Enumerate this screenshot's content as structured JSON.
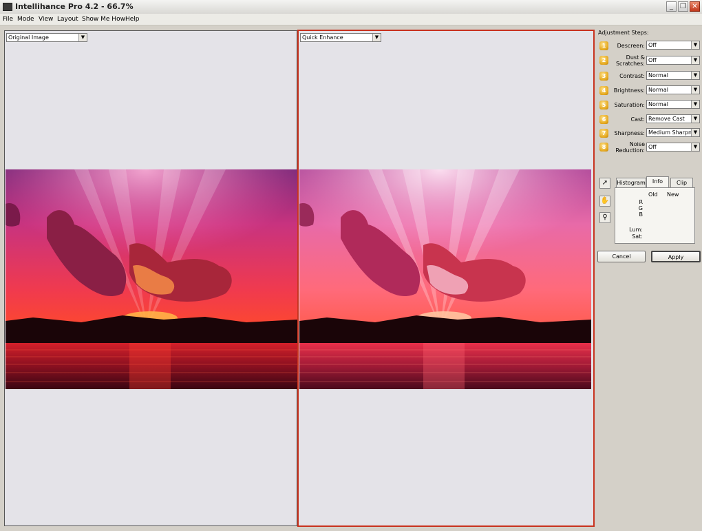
{
  "window": {
    "title": "Intellihance Pro 4.2 - 66.7%",
    "minimize_glyph": "_",
    "restore_glyph": "❐",
    "close_glyph": "✕"
  },
  "menu": [
    "File",
    "Mode",
    "View",
    "Layout",
    "Show Me How",
    "Help"
  ],
  "left_pane": {
    "view_select": "Original Image"
  },
  "right_pane": {
    "view_select": "Quick Enhance"
  },
  "sidebar": {
    "title": "Adjustment Steps:",
    "steps": [
      {
        "num": "1",
        "label": "Descreen:",
        "value": "Off"
      },
      {
        "num": "2",
        "label": "Dust & Scratches:",
        "value": "Off"
      },
      {
        "num": "3",
        "label": "Contrast:",
        "value": "Normal"
      },
      {
        "num": "4",
        "label": "Brightness:",
        "value": "Normal"
      },
      {
        "num": "5",
        "label": "Saturation:",
        "value": "Normal"
      },
      {
        "num": "6",
        "label": "Cast:",
        "value": "Remove Cast"
      },
      {
        "num": "7",
        "label": "Sharpness:",
        "value": "Medium Sharpness"
      },
      {
        "num": "8",
        "label": "Noise Reduction:",
        "value": "Off"
      }
    ],
    "tools": [
      {
        "icon": "arrow-pointer-icon",
        "glyph": "➚"
      },
      {
        "icon": "hand-icon",
        "glyph": "✋"
      },
      {
        "icon": "magnifier-icon",
        "glyph": "⚲"
      }
    ],
    "tabs": [
      "Histogram",
      "Info",
      "Clip"
    ],
    "active_tab": "Info",
    "info": {
      "col_old": "Old",
      "col_new": "New",
      "rows": [
        "R",
        "G",
        "B",
        "Lum:",
        "Sat:"
      ]
    },
    "cancel_label": "Cancel",
    "apply_label": "Apply"
  },
  "colors": {
    "selected_pane_border": "#c8321e",
    "step_badge": "#e3a51a"
  }
}
